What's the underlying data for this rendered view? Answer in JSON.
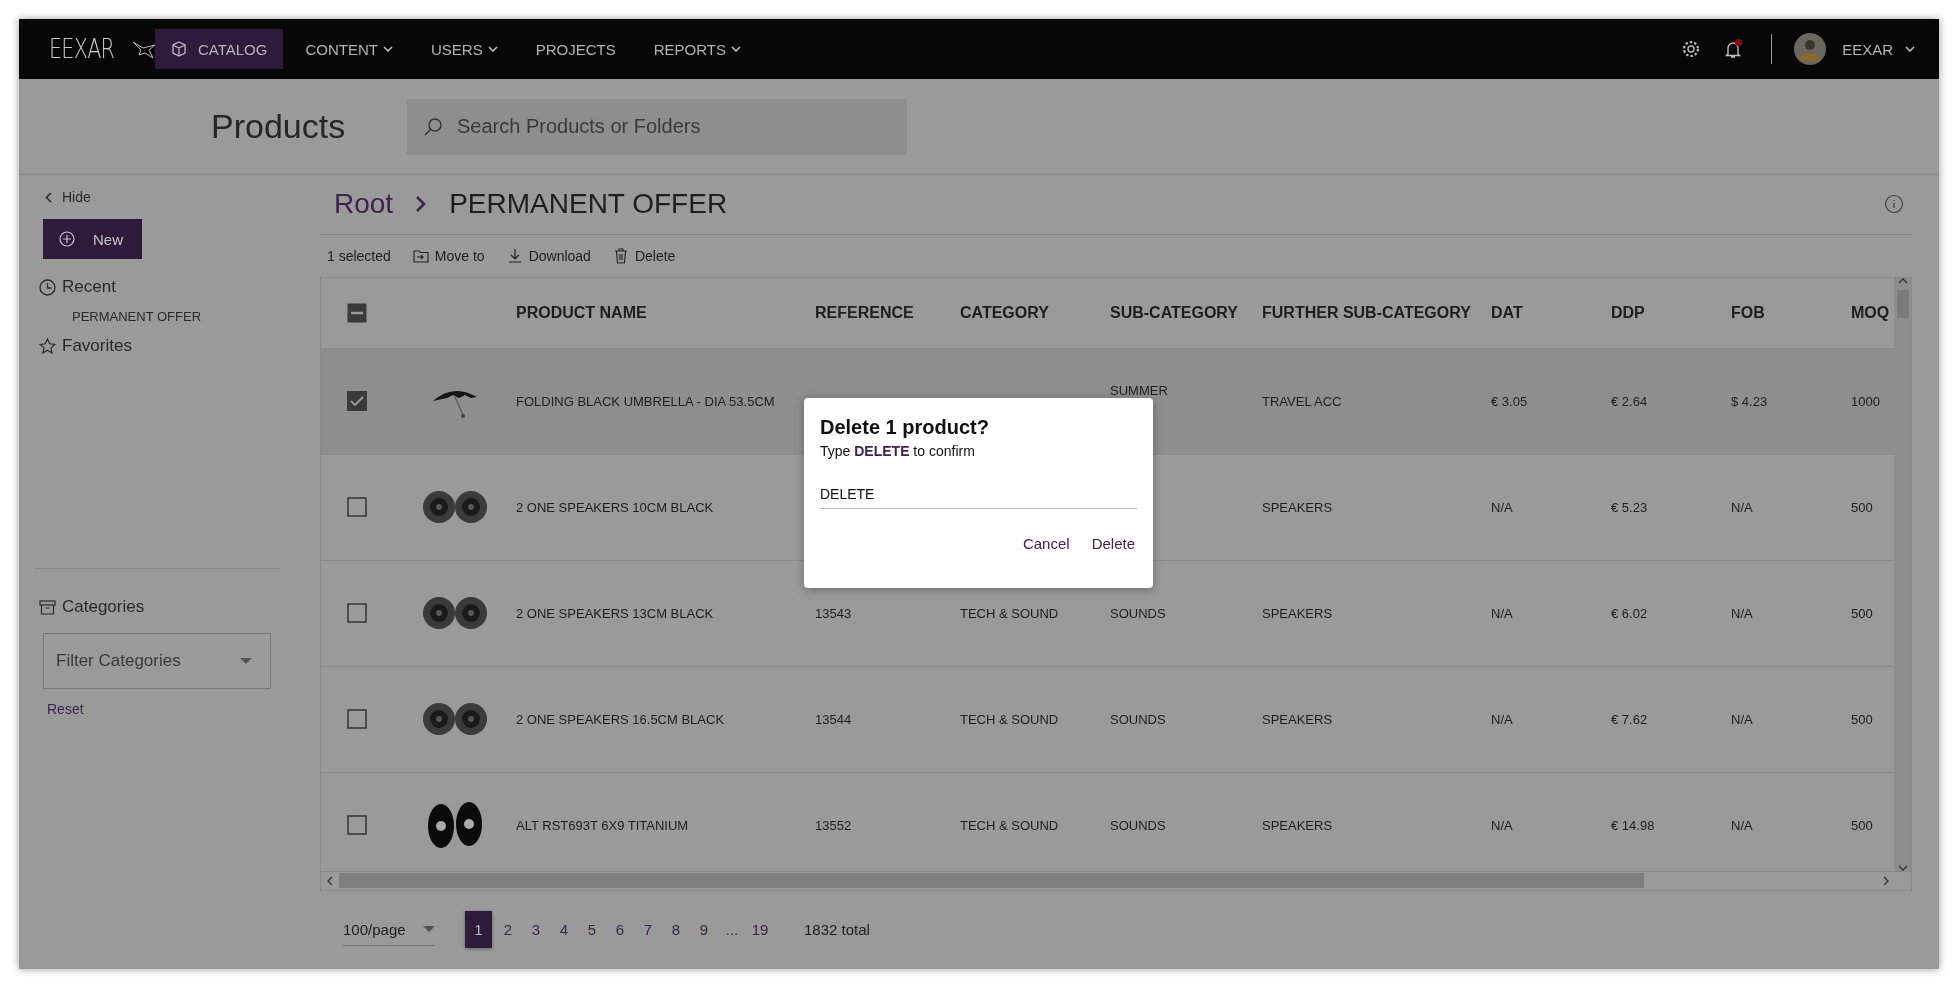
{
  "topbar": {
    "logo": "EEXAR",
    "nav": [
      {
        "label": "CATALOG",
        "selected": true,
        "dropdown": false
      },
      {
        "label": "CONTENT",
        "selected": false,
        "dropdown": true
      },
      {
        "label": "USERS",
        "selected": false,
        "dropdown": true
      },
      {
        "label": "PROJECTS",
        "selected": false,
        "dropdown": false
      },
      {
        "label": "REPORTS",
        "selected": false,
        "dropdown": true
      }
    ],
    "notification_dot": true,
    "user": "EEXAR"
  },
  "header": {
    "title": "Products",
    "search_placeholder": "Search Products or Folders"
  },
  "sidebar": {
    "hide": "Hide",
    "new_button": "New",
    "recent": "Recent",
    "recent_items": [
      "PERMANENT OFFER"
    ],
    "favorites": "Favorites",
    "categories": "Categories",
    "filter_placeholder": "Filter Categories",
    "reset": "Reset"
  },
  "breadcrumb": [
    "Root",
    "PERMANENT OFFER"
  ],
  "toolbar": {
    "selection": "1 selected",
    "actions": [
      {
        "kind": "move",
        "label": "Move to"
      },
      {
        "kind": "download",
        "label": "Download"
      },
      {
        "kind": "delete",
        "label": "Delete"
      }
    ]
  },
  "table": {
    "select_all_partial": true,
    "columns": [
      "PRODUCT NAME",
      "REFERENCE",
      "CATEGORY",
      "SUB-CATEGORY",
      "FURTHER SUB-CATEGORY",
      "DAT",
      "DDP",
      "FOB",
      "MOQ"
    ],
    "rows": [
      {
        "selected": true,
        "product_name": "FOLDING BLACK UMBRELLA - DIA 53.5CM",
        "sub_category": "SUMMER",
        "further_sub_category": "TRAVEL ACC",
        "dat": "€ 3.05",
        "ddp": "€ 2.64",
        "fob": "$ 4.23",
        "moq": "1000"
      },
      {
        "selected": false,
        "product_name": "2 ONE SPEAKERS 10CM BLACK",
        "further_sub_category": "SPEAKERS",
        "dat": "N/A",
        "ddp": "€ 5.23",
        "fob": "N/A",
        "moq": "500"
      },
      {
        "selected": false,
        "product_name": "2 ONE SPEAKERS 13CM BLACK",
        "reference": "13543",
        "category": "TECH & SOUND",
        "sub_category": "SOUNDS",
        "further_sub_category": "SPEAKERS",
        "dat": "N/A",
        "ddp": "€ 6.02",
        "fob": "N/A",
        "moq": "500"
      },
      {
        "selected": false,
        "product_name": "2 ONE SPEAKERS 16.5CM BLACK",
        "reference": "13544",
        "category": "TECH & SOUND",
        "sub_category": "SOUNDS",
        "further_sub_category": "SPEAKERS",
        "dat": "N/A",
        "ddp": "€ 7.62",
        "fob": "N/A",
        "moq": "500"
      },
      {
        "selected": false,
        "product_name": "ALT RST693T 6X9 TITANIUM",
        "reference": "13552",
        "category": "TECH & SOUND",
        "sub_category": "SOUNDS",
        "further_sub_category": "SPEAKERS",
        "dat": "N/A",
        "ddp": "€ 14.98",
        "fob": "N/A",
        "moq": "500"
      }
    ]
  },
  "pagination": {
    "page_size": "100/page",
    "pages": [
      {
        "label": "1",
        "selected": true
      },
      {
        "label": "2",
        "selected": false
      },
      {
        "label": "3",
        "selected": false
      },
      {
        "label": "4",
        "selected": false
      },
      {
        "label": "5",
        "selected": false
      },
      {
        "label": "6",
        "selected": false
      },
      {
        "label": "7",
        "selected": false
      },
      {
        "label": "8",
        "selected": false
      },
      {
        "label": "9",
        "selected": false
      },
      {
        "label": "...",
        "selected": false
      },
      {
        "label": "19",
        "selected": false
      }
    ],
    "total": "1832 total"
  },
  "dialog": {
    "title": "Delete 1 product?",
    "message": "Type **DELETE** to confirm",
    "value": "DELETE",
    "buttons": [
      "Cancel",
      "Delete"
    ]
  }
}
